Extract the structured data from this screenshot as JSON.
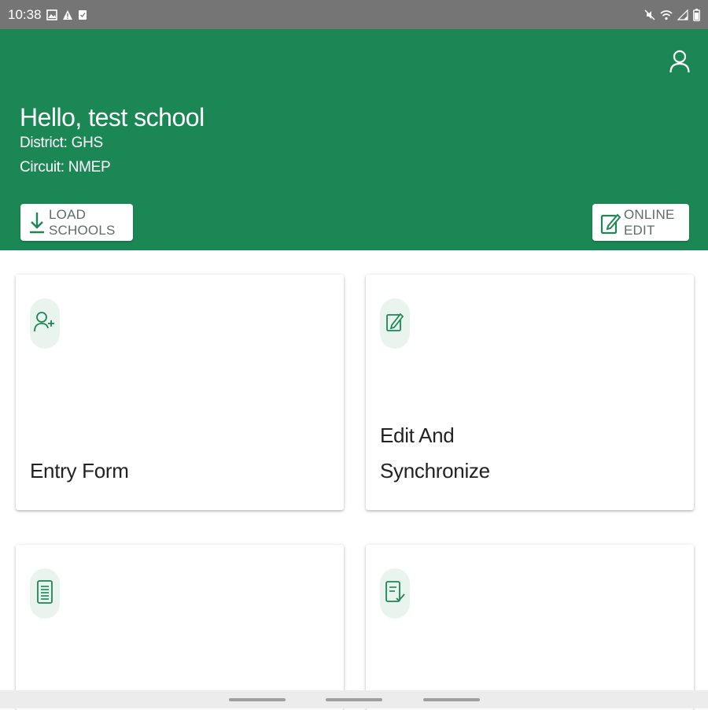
{
  "status_bar": {
    "time": "10:38",
    "left_icons": [
      "image-icon",
      "warning-icon",
      "shield-icon"
    ],
    "right_icons": [
      "mute-icon",
      "wifi-icon",
      "signal-icon",
      "battery-icon"
    ]
  },
  "header": {
    "greeting": "Hello, test school",
    "district": "District: GHS",
    "circuit": "Circuit: NMEP",
    "load_schools_label": "LOAD SCHOOLS",
    "online_edit_label": "ONLINE EDIT",
    "background_color": "#1b8754"
  },
  "cards": [
    {
      "label_lines": [
        "Entry Form"
      ],
      "icon": "user-add-icon"
    },
    {
      "label_lines": [
        "Edit And",
        "Synchronize"
      ],
      "icon": "edit-square-icon"
    },
    {
      "label_lines": [],
      "icon": "list-document-icon"
    },
    {
      "label_lines": [],
      "icon": "document-check-icon"
    }
  ],
  "colors": {
    "accent": "#1b8754",
    "icon_circle": "#e9f4ee",
    "status_bar": "#757575"
  }
}
